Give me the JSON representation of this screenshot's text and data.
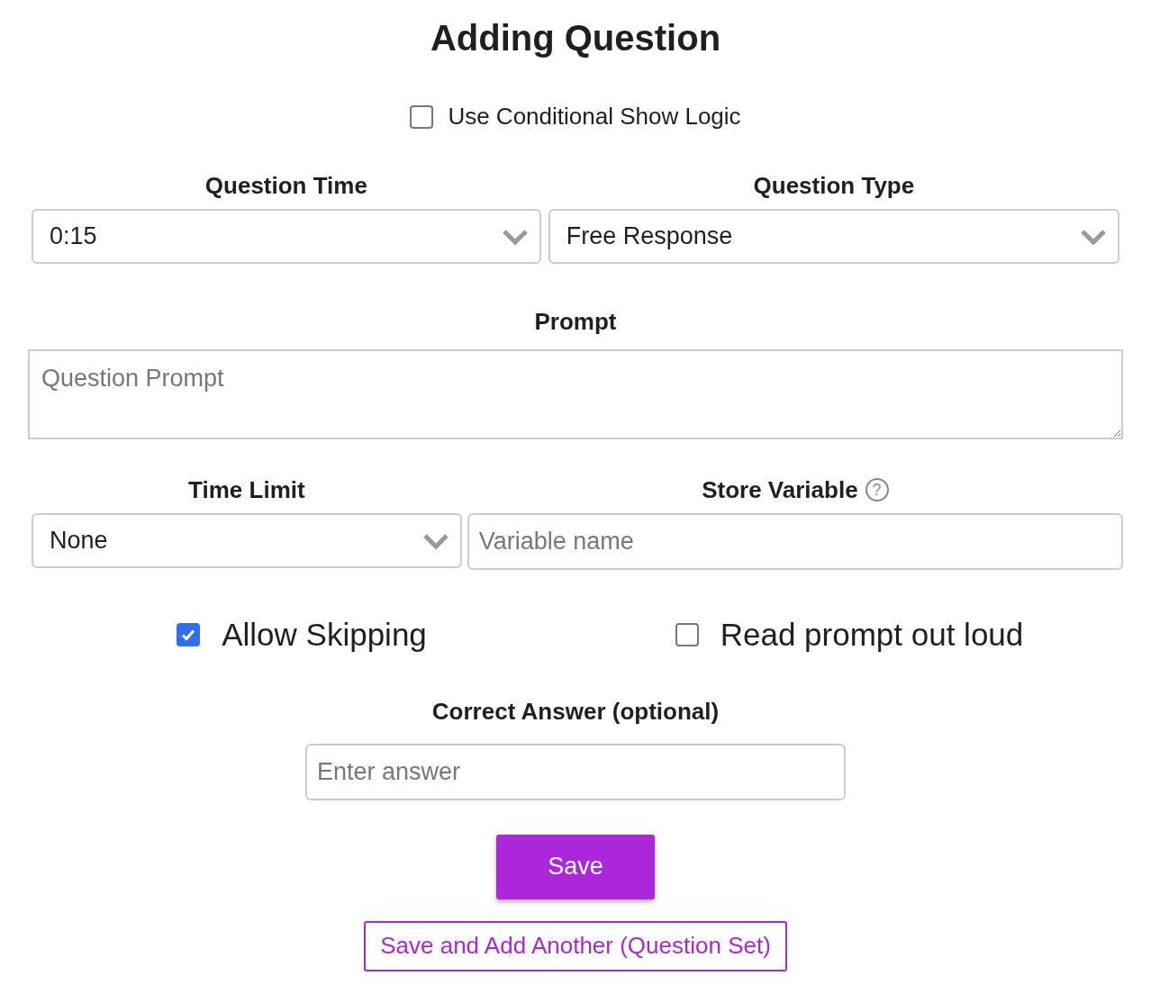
{
  "title": "Adding Question",
  "conditional_logic": {
    "label": "Use Conditional Show Logic",
    "checked": false
  },
  "row1": [
    {
      "label": "Question Time",
      "kind": "select",
      "value": "0:15"
    },
    {
      "label": "Question Type",
      "kind": "select",
      "value": "Free Response"
    }
  ],
  "prompt": {
    "label": "Prompt",
    "placeholder": "Question Prompt"
  },
  "row2": [
    {
      "label": "Time Limit",
      "kind": "select",
      "value": "None"
    },
    {
      "label": "Store Variable",
      "kind": "input",
      "placeholder": "Variable name",
      "help": "?"
    }
  ],
  "options": [
    {
      "label": "Allow Skipping",
      "checked": true
    },
    {
      "label": "Read prompt out loud",
      "checked": false
    }
  ],
  "correct_answer": {
    "label": "Correct Answer (optional)",
    "placeholder": "Enter answer"
  },
  "buttons": [
    {
      "label": "Save",
      "kind": "primary"
    },
    {
      "label": "Save and Add Another (Question Set)",
      "kind": "outline"
    }
  ]
}
